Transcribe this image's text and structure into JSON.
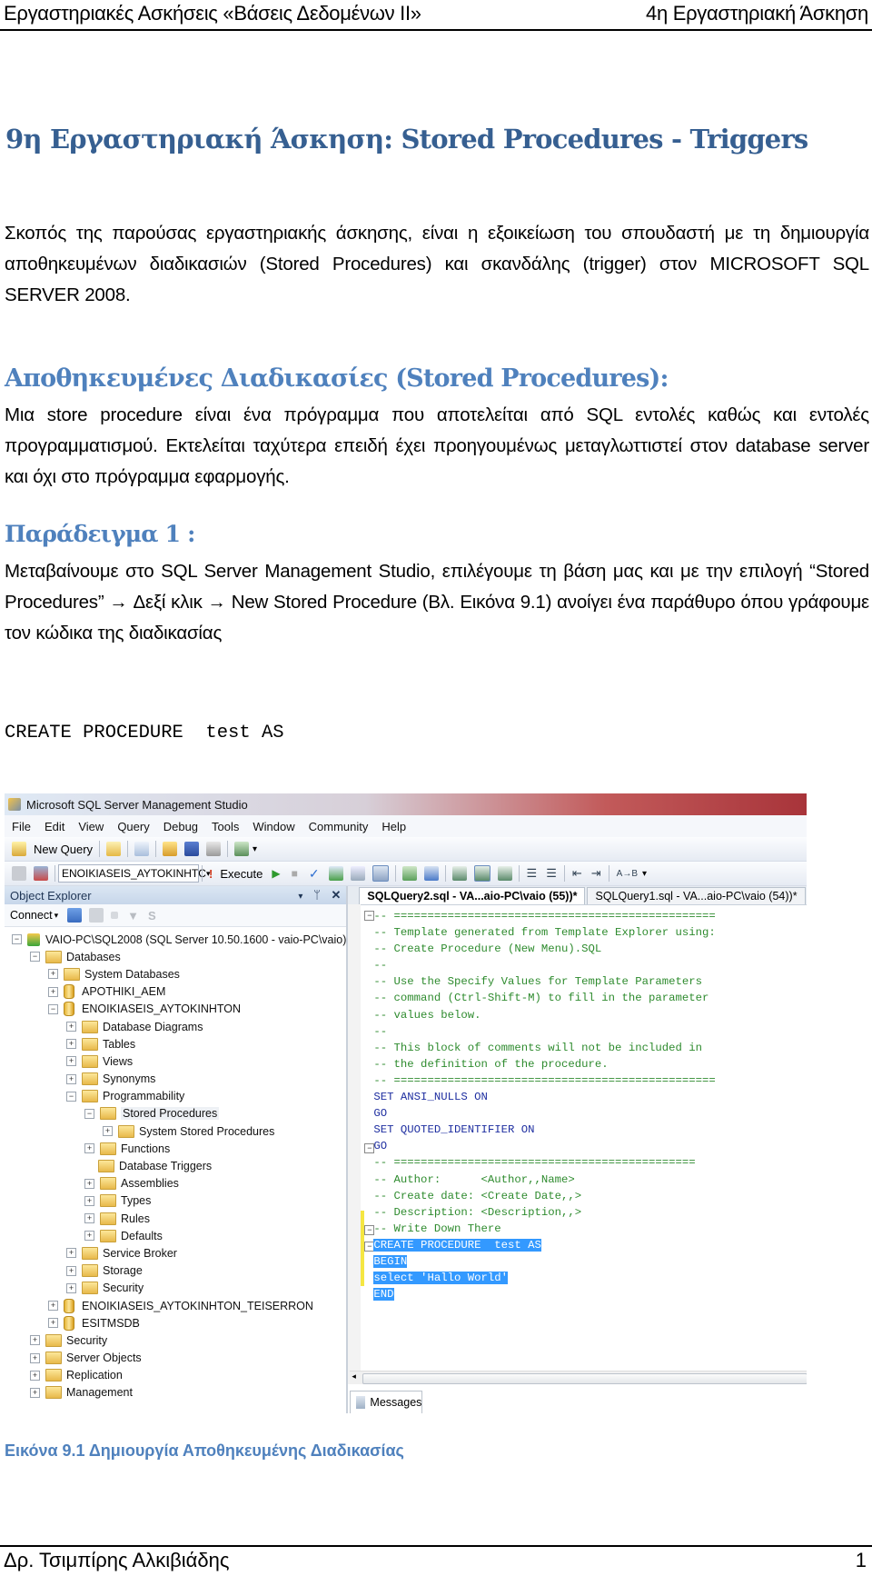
{
  "header": {
    "left": "Εργαστηριακές Ασκήσεις «Βάσεις Δεδομένων ΙΙ»",
    "right": "4η Εργαστηριακή Άσκηση"
  },
  "title": "9η Εργαστηριακή Άσκηση: Stored Procedures - Triggers",
  "intro": "Σκοπός της παρούσας εργαστηριακής άσκησης, είναι η εξοικείωση του σπουδαστή με τη δημιουργία αποθηκευμένων διαδικασιών (Stored Procedures) και σκανδάλης (trigger) στον MICROSOFT SQL SERVER 2008.",
  "section1": {
    "heading": "Αποθηκευμένες Διαδικασίες (Stored Procedures):",
    "text": "Μια store procedure είναι  ένα πρόγραμμα που αποτελείται από SQL εντολές καθώς και εντολές προγραμματισμού. Εκτελείται ταχύτερα επειδή έχει προηγουμένως μεταγλωττιστεί στον database server και όχι στο  πρόγραμμα εφαρμογής."
  },
  "example1": {
    "heading": "Παράδειγμα 1 :",
    "text": "Μεταβαίνουμε στο  SQL Server Management Studio, επιλέγουμε τη βάση μας και με την επιλογή  “Stored Procedures” → Δεξί κλικ → New Stored Procedure (Βλ. Εικόνα 9.1)  ανοίγει ένα παράθυρο όπου γράφουμε τον κώδικα της διαδικασίας",
    "code": [
      "CREATE PROCEDURE  test AS",
      "BEGIN",
      "select \"Hallo World\"",
      "END"
    ]
  },
  "ssms": {
    "window_title": "Microsoft SQL Server Management Studio",
    "menu": [
      "File",
      "Edit",
      "View",
      "Query",
      "Debug",
      "Tools",
      "Window",
      "Community",
      "Help"
    ],
    "toolbar": {
      "new_query": "New Query",
      "database": "ENOIKIASEIS_AYTOKINHTC",
      "execute": "Execute"
    },
    "object_explorer": {
      "title": "Object Explorer",
      "connect": "Connect",
      "tree": [
        {
          "label": "VAIO-PC\\SQL2008 (SQL Server 10.50.1600 - vaio-PC\\vaio)",
          "level": 0,
          "state": "expanded",
          "icon": "server-icon"
        },
        {
          "label": "Databases",
          "level": 1,
          "state": "expanded",
          "icon": "folder-icon"
        },
        {
          "label": "System Databases",
          "level": 2,
          "state": "collapsed",
          "icon": "folder-icon"
        },
        {
          "label": "APOTHIKI_AEM",
          "level": 2,
          "state": "collapsed",
          "icon": "database-icon"
        },
        {
          "label": "ENOIKIASEIS_AYTOKINHTON",
          "level": 2,
          "state": "expanded",
          "icon": "database-icon"
        },
        {
          "label": "Database Diagrams",
          "level": 3,
          "state": "collapsed",
          "icon": "folder-icon"
        },
        {
          "label": "Tables",
          "level": 3,
          "state": "collapsed",
          "icon": "folder-icon"
        },
        {
          "label": "Views",
          "level": 3,
          "state": "collapsed",
          "icon": "folder-icon"
        },
        {
          "label": "Synonyms",
          "level": 3,
          "state": "collapsed",
          "icon": "folder-icon"
        },
        {
          "label": "Programmability",
          "level": 3,
          "state": "expanded",
          "icon": "folder-icon"
        },
        {
          "label": "Stored Procedures",
          "level": 4,
          "state": "expanded",
          "icon": "folder-icon",
          "selected": true
        },
        {
          "label": "System Stored Procedures",
          "level": 5,
          "state": "collapsed",
          "icon": "folder-icon"
        },
        {
          "label": "Functions",
          "level": 4,
          "state": "collapsed",
          "icon": "folder-icon"
        },
        {
          "label": "Database Triggers",
          "level": 4,
          "state": "none",
          "icon": "folder-icon"
        },
        {
          "label": "Assemblies",
          "level": 4,
          "state": "collapsed",
          "icon": "folder-icon"
        },
        {
          "label": "Types",
          "level": 4,
          "state": "collapsed",
          "icon": "folder-icon"
        },
        {
          "label": "Rules",
          "level": 4,
          "state": "collapsed",
          "icon": "folder-icon"
        },
        {
          "label": "Defaults",
          "level": 4,
          "state": "collapsed",
          "icon": "folder-icon"
        },
        {
          "label": "Service Broker",
          "level": 3,
          "state": "collapsed",
          "icon": "folder-icon"
        },
        {
          "label": "Storage",
          "level": 3,
          "state": "collapsed",
          "icon": "folder-icon"
        },
        {
          "label": "Security",
          "level": 3,
          "state": "collapsed",
          "icon": "folder-icon"
        },
        {
          "label": "ENOIKIASEIS_AYTOKINHTON_TEISERRON",
          "level": 2,
          "state": "collapsed",
          "icon": "database-icon"
        },
        {
          "label": "ESITMSDB",
          "level": 2,
          "state": "collapsed",
          "icon": "database-icon"
        },
        {
          "label": "Security",
          "level": 1,
          "state": "collapsed",
          "icon": "folder-icon"
        },
        {
          "label": "Server Objects",
          "level": 1,
          "state": "collapsed",
          "icon": "folder-icon"
        },
        {
          "label": "Replication",
          "level": 1,
          "state": "collapsed",
          "icon": "folder-icon"
        },
        {
          "label": "Management",
          "level": 1,
          "state": "collapsed",
          "icon": "folder-icon"
        }
      ]
    },
    "editor": {
      "tabs": [
        "SQLQuery2.sql - VA...aio-PC\\vaio (55))*",
        "SQLQuery1.sql - VA...aio-PC\\vaio (54))*"
      ],
      "lines": [
        {
          "text": "-- ================================================",
          "type": "comment"
        },
        {
          "text": "-- Template generated from Template Explorer using:",
          "type": "comment"
        },
        {
          "text": "-- Create Procedure (New Menu).SQL",
          "type": "comment"
        },
        {
          "text": "--",
          "type": "comment"
        },
        {
          "text": "-- Use the Specify Values for Template Parameters",
          "type": "comment"
        },
        {
          "text": "-- command (Ctrl-Shift-M) to fill in the parameter",
          "type": "comment"
        },
        {
          "text": "-- values below.",
          "type": "comment"
        },
        {
          "text": "--",
          "type": "comment"
        },
        {
          "text": "-- This block of comments will not be included in",
          "type": "comment"
        },
        {
          "text": "-- the definition of the procedure.",
          "type": "comment"
        },
        {
          "text": "-- ================================================",
          "type": "comment"
        },
        {
          "text": "SET ANSI_NULLS ON",
          "type": "keyword"
        },
        {
          "text": "GO",
          "type": "keyword"
        },
        {
          "text": "SET QUOTED_IDENTIFIER ON",
          "type": "keyword"
        },
        {
          "text": "GO",
          "type": "keyword"
        },
        {
          "text": "-- =============================================",
          "type": "comment"
        },
        {
          "text": "-- Author:      <Author,,Name>",
          "type": "comment"
        },
        {
          "text": "-- Create date: <Create Date,,>",
          "type": "comment"
        },
        {
          "text": "-- Description: <Description,,>",
          "type": "comment"
        },
        {
          "text": "-- Write Down There",
          "type": "comment"
        },
        {
          "text": "CREATE PROCEDURE  test AS",
          "type": "selected"
        },
        {
          "text": "BEGIN",
          "type": "selected"
        },
        {
          "text": "select 'Hallo World'",
          "type": "selected"
        },
        {
          "text": "END",
          "type": "selected"
        }
      ],
      "results_tab": "Messages"
    }
  },
  "caption": "Εικόνα 9.1 Δημιουργία Αποθηκευμένης Διαδικασίας",
  "footer": {
    "author": "Δρ. Τσιμπίρης Αλκιβιάδης",
    "page": "1"
  }
}
